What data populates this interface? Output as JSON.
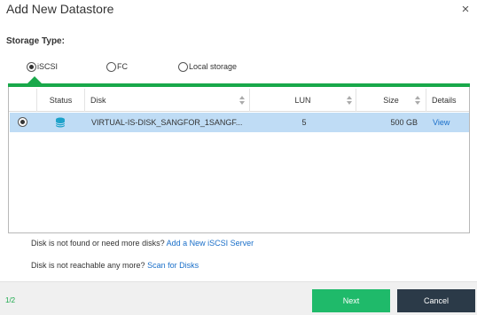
{
  "dialog": {
    "title": "Add New Datastore",
    "close_icon": "×"
  },
  "storage_type": {
    "label": "Storage Type:",
    "options": [
      {
        "label": "iSCSI",
        "selected": true
      },
      {
        "label": "FC",
        "selected": false
      },
      {
        "label": "Local storage",
        "selected": false
      }
    ]
  },
  "table": {
    "columns": [
      "Status",
      "Disk",
      "LUN",
      "Size",
      "Details"
    ],
    "rows": [
      {
        "selected": true,
        "status_icon": "database-icon",
        "disk": "VIRTUAL-IS-DISK_SANGFOR_1SANGF...",
        "lun": "5",
        "size": "500 GB",
        "details": "View"
      }
    ]
  },
  "messages": {
    "not_found_text": "Disk is not found or need more disks?",
    "not_found_link": "Add a New iSCSI Server",
    "not_reachable_text": "Disk is not reachable any more?",
    "not_reachable_link": "Scan for Disks"
  },
  "footer": {
    "page": "1/2",
    "next_label": "Next",
    "cancel_label": "Cancel"
  },
  "colors": {
    "accent": "#19a84a",
    "selected_row": "#bfdcf5",
    "next_button": "#1fba6a",
    "cancel_button": "#2b3a48",
    "link": "#1a6fc9"
  }
}
